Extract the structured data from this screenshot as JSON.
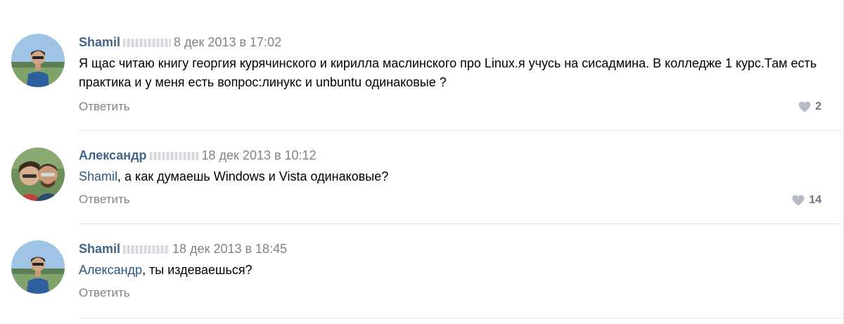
{
  "comments": [
    {
      "author": "Shamil",
      "date": "8 дек 2013 в 17:02",
      "text": "Я щас читаю книгу георгия курячинского и кирилла маслинского про Linux.я учусь на сисадмина. В колледже 1 курс.Там есть практика и у меня есть вопрос:линукс и unbuntu одинаковые ?",
      "reply_label": "Ответить",
      "likes": "2"
    },
    {
      "author": "Александр",
      "date": "18 дек 2013 в 10:12",
      "mention": "Shamil",
      "text": ", а как думаешь Windows и Vista одинаковые?",
      "reply_label": "Ответить",
      "likes": "14"
    },
    {
      "author": "Shamil",
      "date": "18 дек 2013 в 18:45",
      "mention": "Александр",
      "text": ", ты издеваешься?",
      "reply_label": "Ответить"
    }
  ],
  "colors": {
    "author": "#42648b",
    "mention": "#2a5885",
    "meta": "#828282",
    "divider": "#e7e8ec",
    "like_icon": "#b5bcc5"
  },
  "icons": {
    "like": "heart-icon"
  }
}
